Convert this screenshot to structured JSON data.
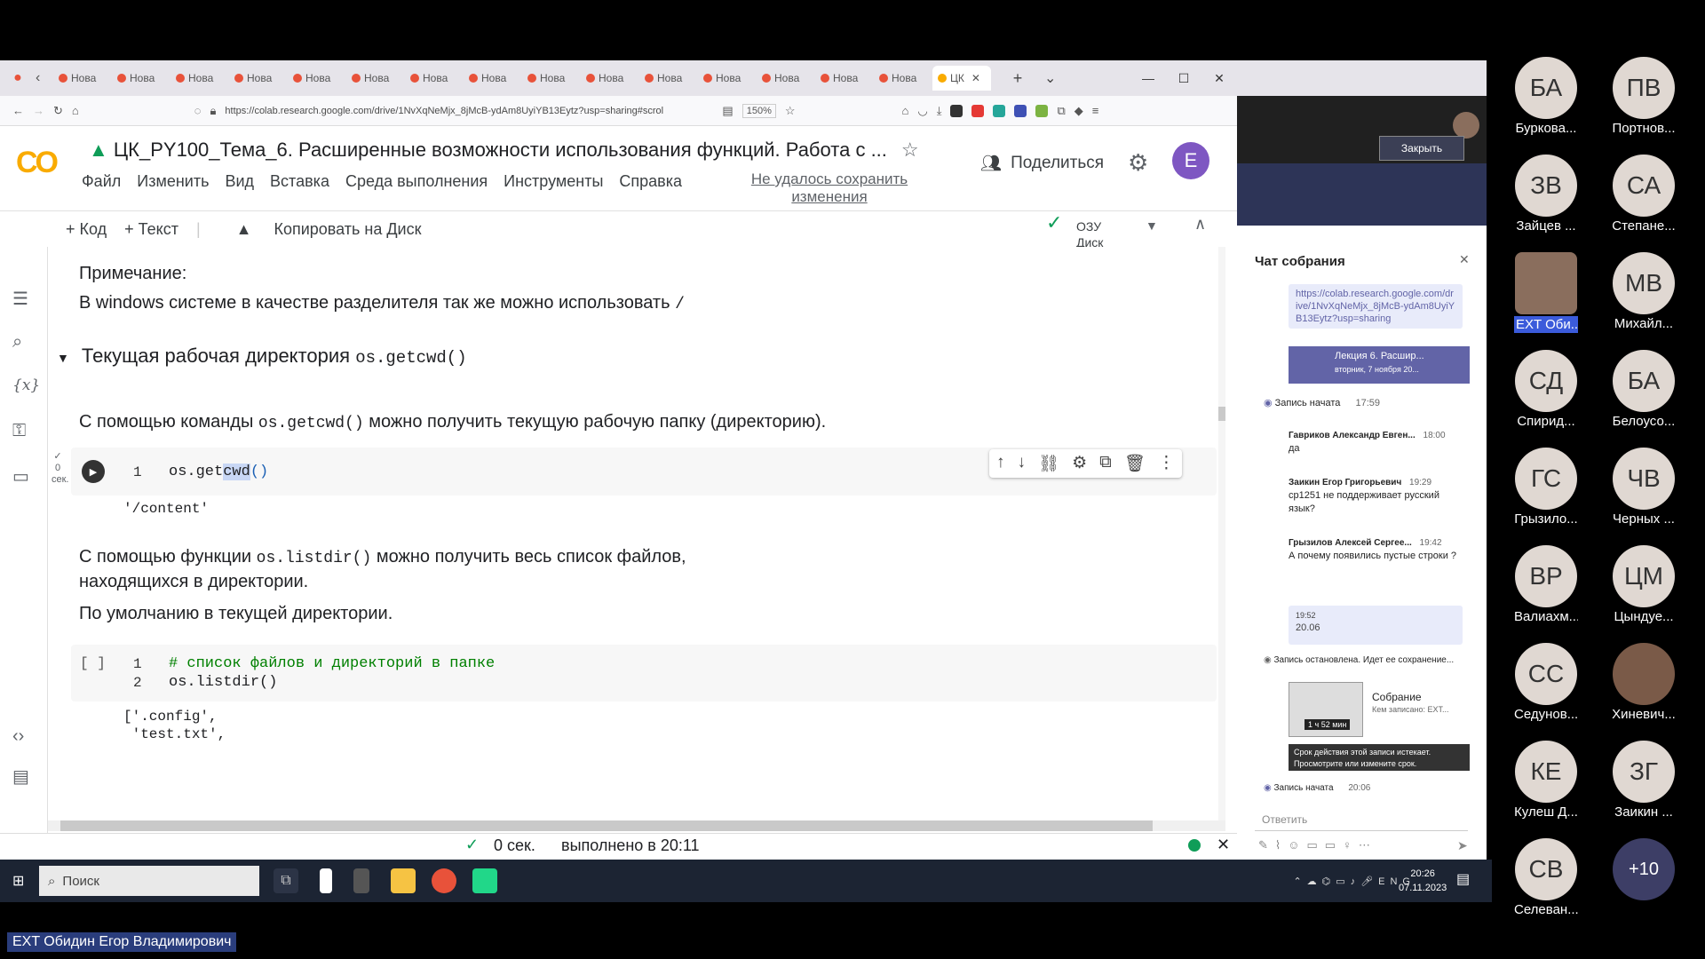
{
  "browser": {
    "tabs": [
      "Нова",
      "Нова",
      "Нова",
      "Нова",
      "Нова",
      "Нова",
      "Нова",
      "Нова",
      "Нова",
      "Нова",
      "Нова",
      "Нова",
      "Нова",
      "Нова",
      "Нова"
    ],
    "active_tab": "ЦК",
    "url": "https://colab.research.google.com/drive/1NvXqNeMjx_8jMcB-ydAm8UyiYB13Eytz?usp=sharing#scrol",
    "zoom": "150%"
  },
  "colab": {
    "logo": "CO",
    "title": "ЦК_PY100_Тема_6. Расширенные возможности использования функций. Работа с  ...",
    "menu": [
      "Файл",
      "Изменить",
      "Вид",
      "Вставка",
      "Среда выполнения",
      "Инструменты",
      "Справка"
    ],
    "save_warning": "Не удалось сохранить изменения",
    "share": "Поделиться",
    "avatar": "E",
    "toolbar": {
      "code": "+ Код",
      "text": "+ Текст",
      "copy": "Копировать на Диск"
    },
    "ram": "ОЗУ",
    "disk": "Диск"
  },
  "notebook": {
    "note_title": "Примечание:",
    "note_text": "В windows системе в качестве разделителя так же можно использовать",
    "note_code": "/",
    "section_title": "Текущая рабочая директория",
    "section_code": "os.getcwd()",
    "p1_before": "С помощью команды",
    "p1_code": "os.getcwd()",
    "p1_after": "можно получить текущую рабочую папку (директорию).",
    "cell1": {
      "line": "1",
      "code_a": "os.get",
      "code_sel": "cwd",
      "code_b": "()",
      "output": "'/content'",
      "exec": "0",
      "exec_unit": "сек."
    },
    "p2_before": "С помощью функции",
    "p2_code": "os.listdir()",
    "p2_after": "можно получить весь список файлов,",
    "p2_line2": "находящихся в директории.",
    "p3": "По умолчанию в текущей директории.",
    "cell2": {
      "bracket": "[ ]",
      "l1": "1",
      "l2": "2",
      "code1": "# список файлов и директорий в папке",
      "code2": "os.listdir()",
      "out1": "['.config',",
      "out2": " 'test.txt',"
    }
  },
  "status": {
    "time": "0 сек.",
    "done": "выполнено в 20:11"
  },
  "taskbar": {
    "search": "Поиск",
    "lang": "ENG",
    "time": "20:26",
    "date": "07.11.2023"
  },
  "teams": {
    "close": "Закрыть",
    "chat_title": "Чат собрания",
    "link": "https://colab.research.google.com/drive/1NvXqNeMjx_8jMcB-ydAm8UyiYB13Eytz?usp=sharing",
    "lecture": "Лекция 6. Расшир...",
    "lecture_date": "вторник, 7 ноября 20...",
    "rec_start": "Запись начата",
    "rec_start_time": "17:59",
    "m1_name": "Гавриков Александр Евген...",
    "m1_time": "18:00",
    "m1_text": "да",
    "m2_name": "Заикин Егор Григорьевич",
    "m2_time": "19:29",
    "m2_text": "cp1251 не поддерживает русский язык?",
    "m3_name": "Грызилов Алексей Сергее...",
    "m3_time": "19:42",
    "m3_text": "А почему появились пустые строки ?",
    "m4_time": "19:52",
    "m4_text": "20.06",
    "rec_stop": "Запись остановлена. Идет ее сохранение...",
    "rec_title": "Собрание",
    "rec_by": "Кем записано: EXT...",
    "rec_len": "1 ч 52 мин",
    "expire": "Срок действия этой записи истекает. Просмотрите или измените срок.",
    "rec_start2": "Запись начата",
    "rec_start2_time": "20:06",
    "reply": "Ответить"
  },
  "participants": [
    {
      "initials": "БА",
      "name": "Буркова..."
    },
    {
      "initials": "ПВ",
      "name": "Портнов..."
    },
    {
      "initials": "ЗВ",
      "name": "Зайцев ..."
    },
    {
      "initials": "СА",
      "name": "Степане..."
    },
    {
      "initials": "",
      "name": "EXT Оби..."
    },
    {
      "initials": "МВ",
      "name": "Михайл..."
    },
    {
      "initials": "СД",
      "name": "Спирид..."
    },
    {
      "initials": "БА",
      "name": "Белоусо..."
    },
    {
      "initials": "ГС",
      "name": "Грызило..."
    },
    {
      "initials": "ЧВ",
      "name": "Черных ..."
    },
    {
      "initials": "ВР",
      "name": "Валиахм..."
    },
    {
      "initials": "ЦМ",
      "name": "Цындуе..."
    },
    {
      "initials": "СС",
      "name": "Седунов..."
    },
    {
      "initials": "",
      "name": "Хиневич..."
    },
    {
      "initials": "КЕ",
      "name": "Кулеш Д..."
    },
    {
      "initials": "ЗГ",
      "name": "Заикин ..."
    },
    {
      "initials": "СВ",
      "name": "Селеван..."
    },
    {
      "initials": "+10",
      "name": ""
    }
  ],
  "speaker": "EXT Обидин Егор Владимирович"
}
